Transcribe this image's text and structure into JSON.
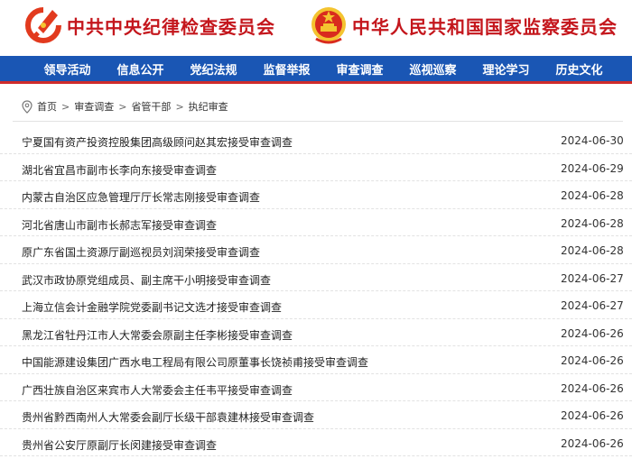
{
  "header": {
    "org1": "中共中央纪律检查委员会",
    "org2": "中华人民共和国国家监察委员会"
  },
  "nav": [
    "领导活动",
    "信息公开",
    "党纪法规",
    "监督举报",
    "审查调查",
    "巡视巡察",
    "理论学习",
    "历史文化"
  ],
  "breadcrumb": {
    "items": [
      "首页",
      "审查调查",
      "省管干部",
      "执纪审查"
    ],
    "separator": ">"
  },
  "articles": [
    {
      "title": "宁夏国有资产投资控股集团高级顾问赵其宏接受审查调查",
      "date": "2024-06-30"
    },
    {
      "title": "湖北省宜昌市副市长李向东接受审查调查",
      "date": "2024-06-29"
    },
    {
      "title": "内蒙古自治区应急管理厅厅长常志刚接受审查调查",
      "date": "2024-06-28"
    },
    {
      "title": "河北省唐山市副市长郝志军接受审查调查",
      "date": "2024-06-28"
    },
    {
      "title": "原广东省国土资源厅副巡视员刘润荣接受审查调查",
      "date": "2024-06-28"
    },
    {
      "title": "武汉市政协原党组成员、副主席干小明接受审查调查",
      "date": "2024-06-27"
    },
    {
      "title": "上海立信会计金融学院党委副书记文选才接受审查调查",
      "date": "2024-06-27"
    },
    {
      "title": "黑龙江省牡丹江市人大常委会原副主任李彬接受审查调查",
      "date": "2024-06-26"
    },
    {
      "title": "中国能源建设集团广西水电工程局有限公司原董事长饶祯甫接受审查调查",
      "date": "2024-06-26"
    },
    {
      "title": "广西壮族自治区来宾市人大常委会主任韦平接受审查调查",
      "date": "2024-06-26"
    },
    {
      "title": "贵州省黔西南州人大常委会副厅长级干部袁建林接受审查调查",
      "date": "2024-06-26"
    },
    {
      "title": "贵州省公安厅原副厅长闵建接受审查调查",
      "date": "2024-06-26"
    }
  ],
  "colors": {
    "brand_red": "#c4161c",
    "nav_blue": "#1a56b4",
    "accent_line": "#cf2b2b",
    "gold": "#f4c430"
  },
  "icons": [
    "party-emblem-icon",
    "national-emblem-icon",
    "location-pin-icon"
  ]
}
